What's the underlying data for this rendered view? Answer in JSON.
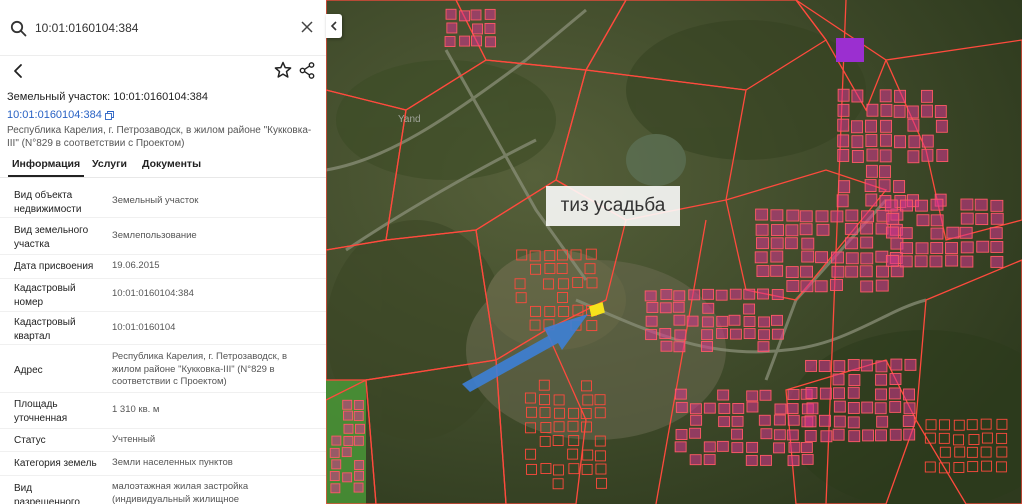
{
  "search": {
    "value": "10:01:0160104:384"
  },
  "header": {
    "title": "Земельный участок: 10:01:0160104:384",
    "cadastral_link": "10:01:0160104:384"
  },
  "address_summary_line1": "Республика Карелия, г. Петрозаводск, в жилом районе \"Кукковка-",
  "address_summary_line2": "III\" (N°829 в соответствии с Проектом)",
  "tabs": [
    {
      "label": "Информация",
      "active": true
    },
    {
      "label": "Услуги",
      "active": false
    },
    {
      "label": "Документы",
      "active": false
    }
  ],
  "info_rows": [
    {
      "key1": "Вид объекта",
      "key2": "недвижимости",
      "val1": "Земельный участок",
      "val2": "",
      "val3": ""
    },
    {
      "key1": "Вид земельного",
      "key2": "участка",
      "val1": "Землепользование",
      "val2": "",
      "val3": ""
    },
    {
      "key1": "Дата присвоения",
      "key2": "",
      "val1": "19.06.2015",
      "val2": "",
      "val3": ""
    },
    {
      "key1": "Кадастровый",
      "key2": "номер",
      "val1": "10:01:0160104:384",
      "val2": "",
      "val3": ""
    },
    {
      "key1": "Кадастровый",
      "key2": "квартал",
      "val1": "10:01:0160104",
      "val2": "",
      "val3": ""
    },
    {
      "key1": "Адрес",
      "key2": "",
      "val1": "Республика Карелия, г. Петрозаводск, в",
      "val2": "жилом районе \"Кукковка-III\" (N°829 в",
      "val3": "соответствии с Проектом)"
    },
    {
      "key1": "Площадь",
      "key2": "уточненная",
      "val1": "1 310 кв. м",
      "val2": "",
      "val3": ""
    },
    {
      "key1": "Статус",
      "key2": "",
      "val1": "Учтенный",
      "val2": "",
      "val3": ""
    },
    {
      "key1": "Категория земель",
      "key2": "",
      "val1": "Земли населенных пунктов",
      "val2": "",
      "val3": ""
    },
    {
      "key1": "Вид",
      "key2": "разрешенного",
      "val1": "малоэтажная жилая застройка",
      "val2": "(индивидуальный жилищное",
      "val3": ""
    }
  ],
  "map": {
    "annotation": "тиз усадьба",
    "watermark": "Yand",
    "colors": {
      "boundary": "#ff4a3d",
      "plot": "#e0389a",
      "highlight": "#f5e21c",
      "arrow": "#3d7fd6",
      "forest": "#3d4a25"
    }
  },
  "icons": [
    "search-icon",
    "clear-icon",
    "back-arrow-icon",
    "star-icon",
    "share-icon",
    "copy-icon",
    "collapse-chevron-icon"
  ]
}
